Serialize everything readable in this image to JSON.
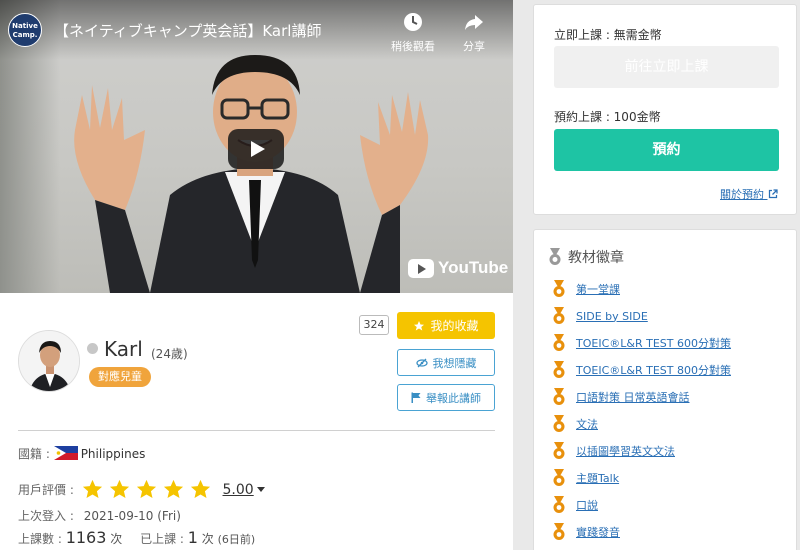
{
  "video": {
    "logo_line1": "Native",
    "logo_line2": "Camp.",
    "title": "【ネイティブキャンプ英会話】Karl講師",
    "watch_later_label": "稍後觀看",
    "share_label": "分享",
    "youtube_label": "YouTube"
  },
  "teacher": {
    "name": "Karl",
    "age": "(24歲)",
    "kids_badge": "對應兒童",
    "favorite_count": "324",
    "favorite_label": "我的收藏",
    "hide_label": "我想隱藏",
    "report_label": "舉報此講師",
    "country_label": "國籍 :",
    "country": "Philippines",
    "rating_label": "用戶評價 :",
    "rating_stars": 5,
    "rating_value": "5.00",
    "last_login_label": "上次登入 :",
    "last_login": "2021-09-10 (Fri)",
    "lessons_label": "上課數 :",
    "lessons_count": "1163",
    "lessons_unit": "次",
    "last_lesson_label": "已上課 :",
    "last_lesson_count": "1",
    "last_lesson_unit": "次",
    "last_lesson_ago": "(6日前)"
  },
  "booking": {
    "instant_label": "立即上課 : 無需金幣",
    "instant_button": "前往立即上課",
    "reserve_label": "預約上課 : 100金幣",
    "reserve_button": "預約",
    "about_link": "關於預約"
  },
  "badges": {
    "title": "教材徽章",
    "items": [
      "第一堂課",
      "SIDE by SIDE",
      "TOEIC®L&R TEST 600分對策",
      "TOEIC®L&R TEST 800分對策",
      "口語對策 日常英語會話",
      "文法",
      "以插圖學習英文文法",
      "主題Talk",
      "口說",
      "實踐發音"
    ]
  },
  "colors": {
    "favorite": "#f5c400",
    "reserve": "#1ec4a4",
    "kids_badge": "#f0a43c",
    "link": "#2a6fb5",
    "badge_icon": "#e8900c"
  }
}
